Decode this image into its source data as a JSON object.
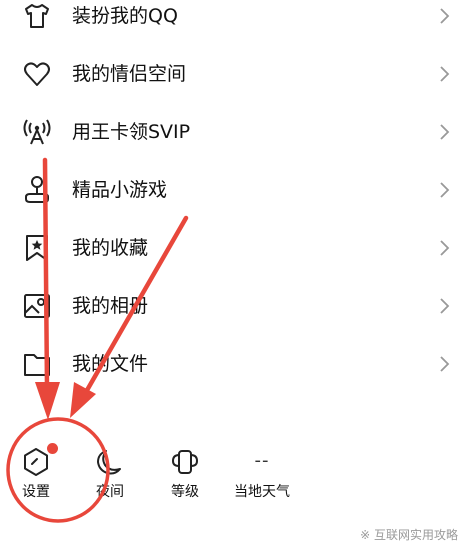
{
  "menu": {
    "items": [
      {
        "label": "装扮我的QQ",
        "icon": "shirt-icon"
      },
      {
        "label": "我的情侣空间",
        "icon": "heart-icon"
      },
      {
        "label": "用王卡领SVIP",
        "icon": "signal-tower-icon"
      },
      {
        "label": "精品小游戏",
        "icon": "joystick-icon"
      },
      {
        "label": "我的收藏",
        "icon": "bookmark-star-icon"
      },
      {
        "label": "我的相册",
        "icon": "photo-album-icon"
      },
      {
        "label": "我的文件",
        "icon": "folder-icon"
      }
    ]
  },
  "bottom_bar": {
    "settings": {
      "label": "设置",
      "icon": "settings-hexagon-icon",
      "has_badge": true
    },
    "night": {
      "label": "夜间",
      "icon": "moon-icon"
    },
    "level": {
      "label": "等级",
      "icon": "level-badge-icon"
    },
    "weather": {
      "label": "当地天气",
      "value": "--"
    }
  },
  "annotation": {
    "color": "#e8473b",
    "circle_target": "设置",
    "arrow_count": 2
  },
  "watermark": {
    "text": "※ 互联网实用攻略"
  }
}
